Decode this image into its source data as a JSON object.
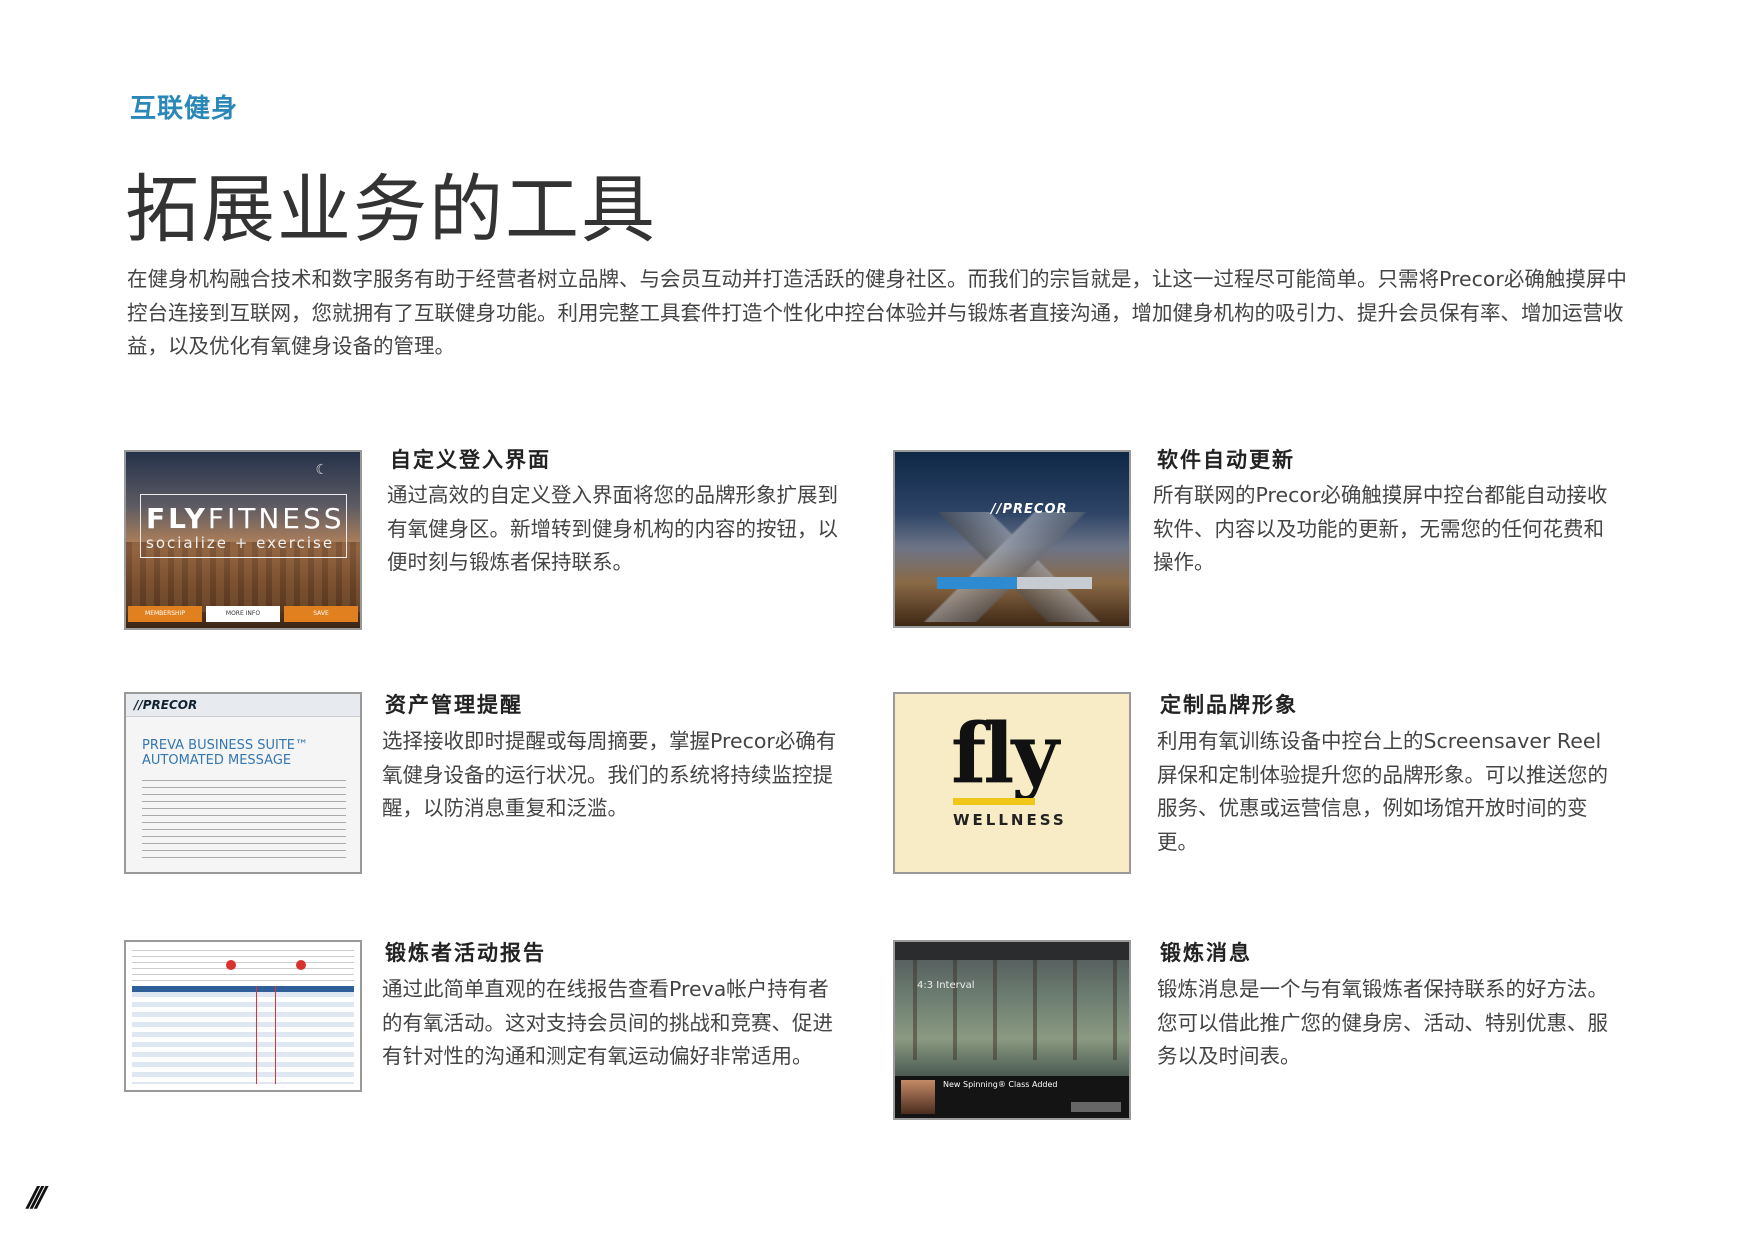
{
  "section_tag": "互联健身",
  "page_title": "拓展业务的工具",
  "intro": "在健身机构融合技术和数字服务有助于经营者树立品牌、与会员互动并打造活跃的健身社区。而我们的宗旨就是，让这一过程尽可能简单。只需将Precor必确触摸屏中控台连接到互联网，您就拥有了互联健身功能。利用完整工具套件打造个性化中控台体验并与锻炼者直接沟通，增加健身机构的吸引力、提升会员保有率、增加运营收益，以及优化有氧健身设备的管理。",
  "features": [
    {
      "title": "自定义登入界面",
      "body": "通过高效的自定义登入界面将您的品牌形象扩展到有氧健身区。新增转到健身机构的内容的按钮，以便时刻与锻炼者保持联系。",
      "thumb": {
        "brand_a": "FLY",
        "brand_b": "FITNESS",
        "tagline": "socialize + exercise",
        "buttons": [
          "MEMBERSHIP",
          "MORE INFO",
          "SAVE"
        ]
      }
    },
    {
      "title": "软件自动更新",
      "body": "所有联网的Precor必确触摸屏中控台都能自动接收软件、内容以及功能的更新，无需您的任何花费和操作。",
      "thumb": {
        "logo": "//PRECOR"
      }
    },
    {
      "title": "资产管理提醒",
      "body": "选择接收即时提醒或每周摘要，掌握Precor必确有氧健身设备的运行状况。我们的系统将持续监控提醒，以防消息重复和泛滥。",
      "thumb": {
        "logo": "//PRECOR",
        "line1": "PREVA BUSINESS SUITE™",
        "line2": "AUTOMATED MESSAGE"
      }
    },
    {
      "title": "定制品牌形象",
      "body": "利用有氧训练设备中控台上的Screensaver Reel屏保和定制体验提升您的品牌形象。可以推送您的服务、优惠或运营信息，例如场馆开放时间的变更。",
      "thumb": {
        "word": "fly",
        "sub": "WELLNESS"
      }
    },
    {
      "title": "锻炼者活动报告",
      "body": "通过此简单直观的在线报告查看Preva帐户持有者的有氧活动。这对支持会员间的挑战和竞赛、促进有针对性的沟通和测定有氧运动偏好非常适用。",
      "thumb": {}
    },
    {
      "title": "锻炼消息",
      "body": "锻炼消息是一个与有氧锻炼者保持联系的好方法。您可以借此推广您的健身房、活动、特别优惠、服务以及时间表。",
      "thumb": {
        "interval": "4:3 Interval",
        "note": "New Spinning® Class Added"
      }
    }
  ],
  "folio_mark": "///"
}
